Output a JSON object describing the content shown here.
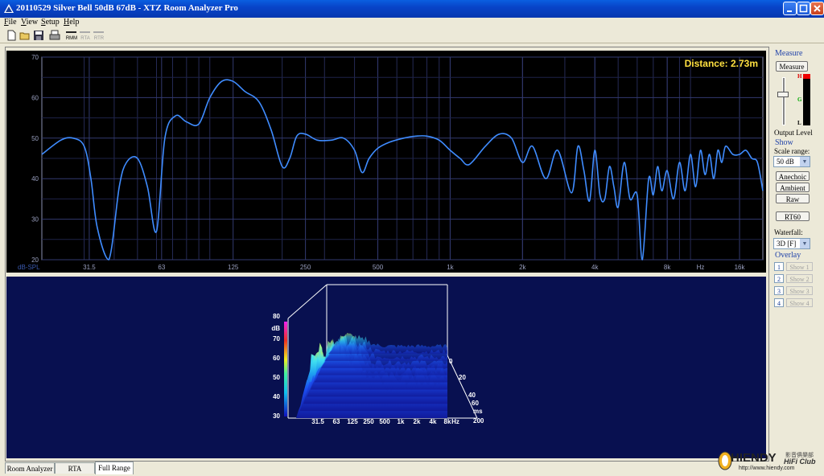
{
  "window": {
    "title": "20110529 Silver Bell 50dB 67dB - XTZ Room Analyzer Pro"
  },
  "menu": [
    {
      "label": "File"
    },
    {
      "label": "View"
    },
    {
      "label": "Setup"
    },
    {
      "label": "Help"
    }
  ],
  "toolbar": {
    "rmm": "RMM",
    "rta": "RTA",
    "rtr": "RTR"
  },
  "frequency_chart": {
    "distance": "Distance: 2.73m",
    "unit_label": "dB-SPL",
    "hz_label": "Hz"
  },
  "chart_data": [
    {
      "type": "line",
      "xscale": "log",
      "x_ticks": [
        31.5,
        63,
        125,
        250,
        500,
        1000,
        2000,
        4000,
        8000,
        16000
      ],
      "x_tick_labels": [
        "31.5",
        "63",
        "125",
        "250",
        "500",
        "1k",
        "2k",
        "4k",
        "8k",
        "16k"
      ],
      "y_ticks": [
        20,
        30,
        40,
        50,
        60,
        70
      ],
      "y_tick_labels": [
        "20",
        "30",
        "40",
        "50",
        "60",
        "70"
      ],
      "xlim": [
        20,
        20000
      ],
      "ylim": [
        20,
        70
      ],
      "grid": true,
      "x": [
        20,
        24,
        27,
        30,
        32,
        34,
        38,
        42,
        45,
        50,
        55,
        60,
        65,
        72,
        80,
        90,
        100,
        112,
        125,
        140,
        160,
        180,
        200,
        215,
        230,
        250,
        280,
        320,
        360,
        400,
        430,
        460,
        500,
        560,
        640,
        720,
        800,
        900,
        1000,
        1100,
        1200,
        1400,
        1600,
        1800,
        2000,
        2200,
        2500,
        2800,
        3200,
        3400,
        3600,
        3800,
        4000,
        4200,
        4400,
        4600,
        4800,
        5000,
        5300,
        5600,
        6000,
        6300,
        6700,
        7000,
        7300,
        7600,
        8000,
        8500,
        9000,
        9500,
        10000,
        10500,
        11000,
        11500,
        12000,
        12500,
        13000,
        13500,
        14000,
        15000,
        16000,
        17000,
        18000,
        19000,
        20000
      ],
      "y": [
        46,
        49.5,
        50,
        48,
        40,
        28,
        20,
        38,
        44,
        45,
        38,
        27,
        50,
        55.5,
        54,
        53.5,
        60,
        64,
        64,
        61.5,
        59,
        52,
        43,
        45,
        50.5,
        51,
        49.5,
        49.5,
        50,
        47,
        41.5,
        45,
        47.5,
        49,
        50,
        50.5,
        50.5,
        49.5,
        47,
        45,
        43.5,
        48,
        51,
        50,
        44,
        48,
        40,
        47,
        36.5,
        48,
        42,
        34.5,
        47,
        36,
        35,
        43,
        38,
        33,
        44,
        35,
        36,
        20,
        40,
        36,
        43,
        37,
        42,
        35,
        44,
        37,
        46,
        38,
        47,
        41,
        46,
        40,
        47,
        44,
        48,
        46,
        46,
        47,
        45,
        44,
        37
      ]
    },
    {
      "type": "waterfall-3d",
      "x_tick_labels": [
        "31.5",
        "63",
        "125",
        "250",
        "500",
        "1k",
        "2k",
        "4k",
        "8k"
      ],
      "x_end_label": "Hz",
      "z_tick_labels": [
        "0",
        "20",
        "40",
        "60"
      ],
      "z_end_label": "ms",
      "z_end_value": "200",
      "y_tick_labels": [
        "30",
        "40",
        "50",
        "60",
        "70",
        "80"
      ],
      "y_unit": "dB"
    }
  ],
  "sidebar": {
    "measure_group": "Measure",
    "measure_button": "Measure",
    "level_h": "H",
    "level_g": "G",
    "level_l": "L",
    "output_level": "Output Level",
    "show_group": "Show",
    "scale_range_label": "Scale range:",
    "scale_range_value": "50 dB",
    "anechoic": "Anechoic",
    "ambient": "Ambient",
    "raw": "Raw",
    "rt60": "RT60",
    "waterfall_label": "Waterfall:",
    "waterfall_value": "3D [F]",
    "overlay_group": "Overlay",
    "overlays": [
      {
        "num": "1",
        "label": "Show 1"
      },
      {
        "num": "2",
        "label": "Show 2"
      },
      {
        "num": "3",
        "label": "Show 3"
      },
      {
        "num": "4",
        "label": "Show 4"
      }
    ]
  },
  "tabs": [
    {
      "label": "Room Analyzer"
    },
    {
      "label": "RTA"
    },
    {
      "label": "Full Range"
    }
  ],
  "watermark": {
    "brand": "HIENDY",
    "chinese": "影音俱樂部",
    "club": "HiFi Club",
    "url": "http://www.hiendy.com"
  },
  "colors": {
    "titlebar": "#0844c8",
    "chart_bg": "#000000",
    "grid": "#2a2f5a",
    "trace": "#3f8cff",
    "waterfall_bg": "#081050",
    "distance_text": "#ffe040"
  }
}
